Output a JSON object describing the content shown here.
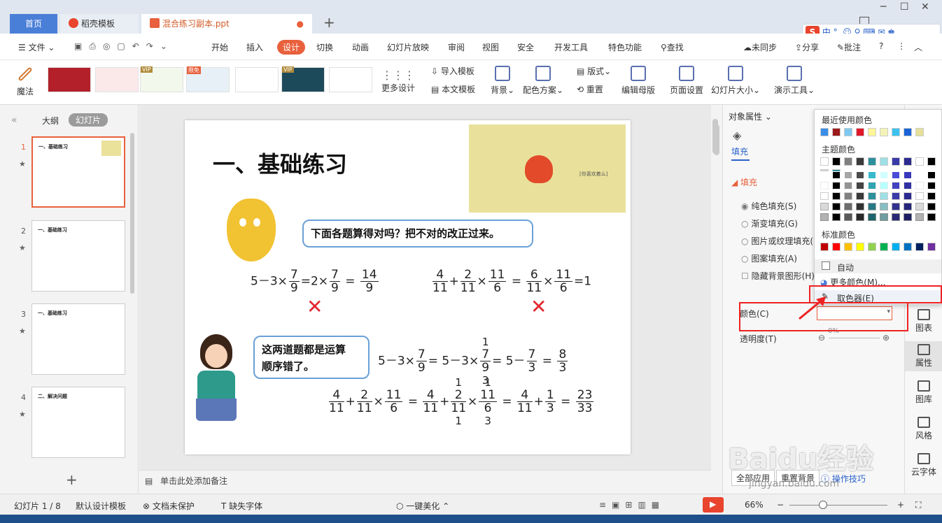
{
  "tabs": [
    {
      "label": "首页"
    },
    {
      "label": "稻壳模板"
    },
    {
      "label": "混合练习副本.ppt"
    }
  ],
  "menu": [
    "文件",
    "开始",
    "插入",
    "设计",
    "切换",
    "动画",
    "幻灯片放映",
    "审阅",
    "视图",
    "安全",
    "开发工具",
    "特色功能",
    "查找"
  ],
  "menu_right": [
    "未同步",
    "分享",
    "批注"
  ],
  "ime_label": "中",
  "ribbon": {
    "magic": "魔法",
    "more_design": "更多设计",
    "import_template": "导入模板",
    "this_template": "本文模板",
    "background": "背景",
    "color_scheme": "配色方案",
    "layout": "版式",
    "reset": "重置",
    "edit_master": "编辑母版",
    "page_setup": "页面设置",
    "slide_size": "幻灯片大小",
    "present_tools": "演示工具",
    "vip": "VIP",
    "limited": "限免"
  },
  "left_tabs": [
    "大纲",
    "幻灯片"
  ],
  "slides": [
    {
      "num": "1",
      "title": "一、基础练习"
    },
    {
      "num": "2",
      "title": "一、基础练习"
    },
    {
      "num": "3",
      "title": "一、基础练习"
    },
    {
      "num": "4",
      "title": "二、解决问题"
    }
  ],
  "slide": {
    "heading": "一、基础练习",
    "q_bubble": "下面各题算得对吗？把不对的改正过来。",
    "a_bubble_1": "这两道题都是运算",
    "a_bubble_2": "顺序错了。",
    "pic_caption": "[你喜欢着么]",
    "eq1": {
      "a": "5－3×",
      "n1": "7",
      "d1": "9",
      "b": "=2×",
      "n2": "7",
      "d2": "9",
      "c": "=",
      "n3": "14",
      "d3": "9"
    },
    "eq2": {
      "n1": "4",
      "d1": "11",
      "p": "+",
      "n2": "2",
      "d2": "11",
      "m": "×",
      "n3": "11",
      "d3": "6",
      "e": "=",
      "n4": "6",
      "d4": "11",
      "m2": "×",
      "n5": "11",
      "d5": "6",
      "r": "=1"
    },
    "eq3": {
      "a": "5－3×",
      "n1": "7",
      "d1": "9",
      "b": "= 5－3×",
      "top": "1",
      "n2": "7",
      "d2": "9",
      "bot": "3",
      "c": "= 5－",
      "n3": "7",
      "d3": "3",
      "e": "=",
      "n4": "8",
      "d4": "3"
    },
    "eq4": {
      "n1": "4",
      "d1": "11",
      "p": "+",
      "n2": "2",
      "d2": "11",
      "m": "×",
      "n3": "11",
      "d3": "6",
      "e": "=",
      "n4": "4",
      "d4": "11",
      "p2": "+",
      "t1": "1",
      "n5": "2",
      "d5": "11",
      "b1": "1",
      "m2": "×",
      "t2": "1",
      "n6": "11",
      "d6": "6",
      "b2": "3",
      "e2": "=",
      "n7": "4",
      "d7": "11",
      "p3": "+",
      "n8": "1",
      "d8": "3",
      "e3": "=",
      "n9": "23",
      "d9": "33"
    },
    "cross": "✕"
  },
  "notes_placeholder": "单击此处添加备注",
  "right_panel": {
    "title": "对象属性",
    "fill_tab": "填充",
    "fill_section": "填充",
    "options": [
      "纯色填充(S)",
      "渐变填充(G)",
      "图片或纹理填充(",
      "图案填充(A)"
    ],
    "hide_bg": "隐藏背景图形(H)",
    "color_label": "颜色(C)",
    "transparency_label": "透明度(T)",
    "transparency_value": "0%",
    "apply_all": "全部应用",
    "reset_bg": "重置背景",
    "tips": "操作技巧"
  },
  "right_tools": [
    "图表",
    "属性",
    "图库",
    "风格",
    "云字体"
  ],
  "color_popup": {
    "recent": "最近使用颜色",
    "theme": "主题颜色",
    "standard": "标准颜色",
    "auto": "自动",
    "more": "更多颜色(M)...",
    "picker": "取色器(E)",
    "recent_colors": [
      "#3a8ee6",
      "#9b1a1a",
      "#7fc8f0",
      "#e0162a",
      "#fff59a",
      "#f4f4b8",
      "#3ec2ef",
      "#1a63d6",
      "#e6e09a"
    ],
    "theme_colors": [
      "#ffffff",
      "#000000",
      "#808080",
      "#3a3a3a",
      "#2b8f9c",
      "#9fe0e6",
      "#3a3aa8",
      "#2b2b8f",
      "#ffffff",
      "#000000",
      "#d0d0d0",
      "#2b8f9c"
    ],
    "standard_colors": [
      "#c00000",
      "#ff0000",
      "#ffc000",
      "#ffff00",
      "#92d050",
      "#00b050",
      "#00b0f0",
      "#0070c0",
      "#002060",
      "#7030a0"
    ]
  },
  "status": {
    "slide_count": "幻灯片 1 / 8",
    "design_template": "默认设计模板",
    "protect": "文档未保护",
    "missing_font": "缺失字体",
    "beautify": "一键美化",
    "zoom": "66%"
  },
  "watermark": "Baidu经验",
  "watermark_url": "jingyan.baidu.com"
}
